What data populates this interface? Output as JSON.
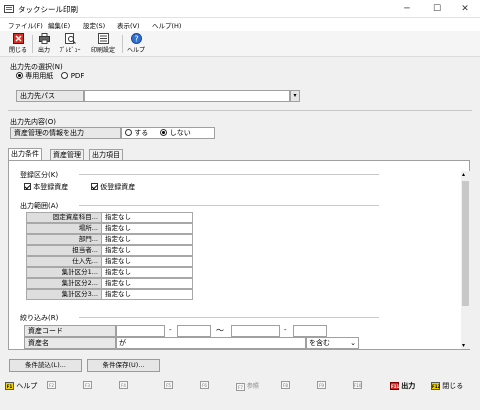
{
  "window": {
    "title": "タックシール印刷",
    "minimize": "─",
    "maximize": "☐",
    "close": "✕"
  },
  "menu": [
    "ファイル(F)",
    "編集(E)",
    "設定(S)",
    "表示(V)",
    "ヘルプ(H)"
  ],
  "toolbar": {
    "close": "閉じる",
    "output": "出力",
    "preview": "ﾌﾟﾚﾋﾞｭｰ",
    "print_settings": "印刷設定",
    "help": "ヘルプ"
  },
  "output_dest": {
    "heading": "出力先の選択(N)",
    "opt_paper": "専用用紙",
    "opt_pdf": "PDF",
    "path_label": "出力先パス",
    "path_value": ""
  },
  "output_content": {
    "heading": "出力先内容(O)",
    "asset_info_label": "資産管理の情報を出力",
    "yes": "する",
    "no": "しない"
  },
  "tabs": [
    "出力条件",
    "資産管理",
    "出力項目"
  ],
  "registration": {
    "heading": "登録区分(K)",
    "main": "本登録資産",
    "temp": "仮登録資産"
  },
  "range": {
    "heading": "出力範囲(A)",
    "rows": [
      {
        "label": "固定資産科目...",
        "value": "指定なし"
      },
      {
        "label": "場所...",
        "value": "指定なし"
      },
      {
        "label": "部門...",
        "value": "指定なし"
      },
      {
        "label": "担当者...",
        "value": "指定なし"
      },
      {
        "label": "仕入先...",
        "value": "指定なし"
      },
      {
        "label": "集計区分1...",
        "value": "指定なし"
      },
      {
        "label": "集計区分2...",
        "value": "指定なし"
      },
      {
        "label": "集計区分3...",
        "value": "指定なし"
      }
    ]
  },
  "filter": {
    "heading": "絞り込み(R)",
    "code_label": "資産コード",
    "dash": "-",
    "tilde": "～",
    "name_label": "資産名",
    "name_particle": "が",
    "match_mode": "を含む"
  },
  "buttons": {
    "load": "条件読込(L)...",
    "save": "条件保存(U)..."
  },
  "fkeys": {
    "f1": "F1",
    "f1_label": "ヘルプ",
    "f2": "F2",
    "f3": "F3",
    "f4": "F4",
    "f5": "F5",
    "f6": "F6",
    "f7": "F7",
    "f7_label": "参照",
    "f8": "F8",
    "f9": "F9",
    "f10": "F10",
    "f11": "F11",
    "f11_label": "出力",
    "f12": "F12",
    "f12_label": "閉じる"
  }
}
